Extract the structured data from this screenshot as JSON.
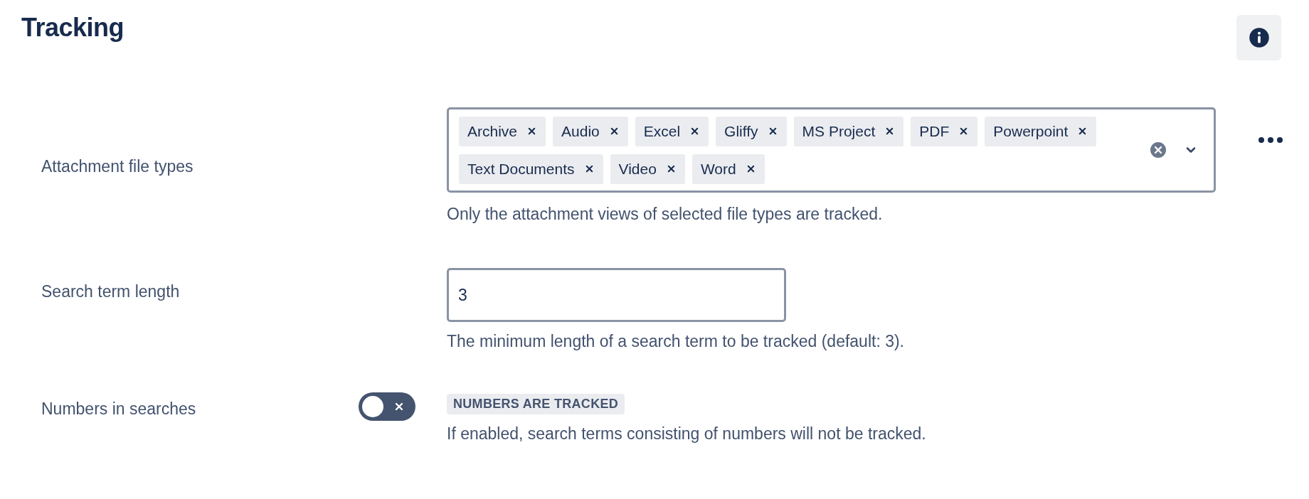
{
  "title": "Tracking",
  "settings": [
    {
      "kind": "multiselect",
      "label": "Attachment file types",
      "tags": [
        "Archive",
        "Audio",
        "Excel",
        "Gliffy",
        "MS Project",
        "PDF",
        "Powerpoint",
        "Text Documents",
        "Video",
        "Word"
      ],
      "help": "Only the attachment views of selected file types are tracked."
    },
    {
      "kind": "number",
      "label": "Search term length",
      "value": "3",
      "help": "The minimum length of a search term to be tracked (default: 3)."
    },
    {
      "kind": "toggle",
      "label": "Numbers in searches",
      "on": false,
      "status": "NUMBERS ARE TRACKED",
      "help": "If enabled, search terms consisting of numbers will not be tracked."
    }
  ]
}
